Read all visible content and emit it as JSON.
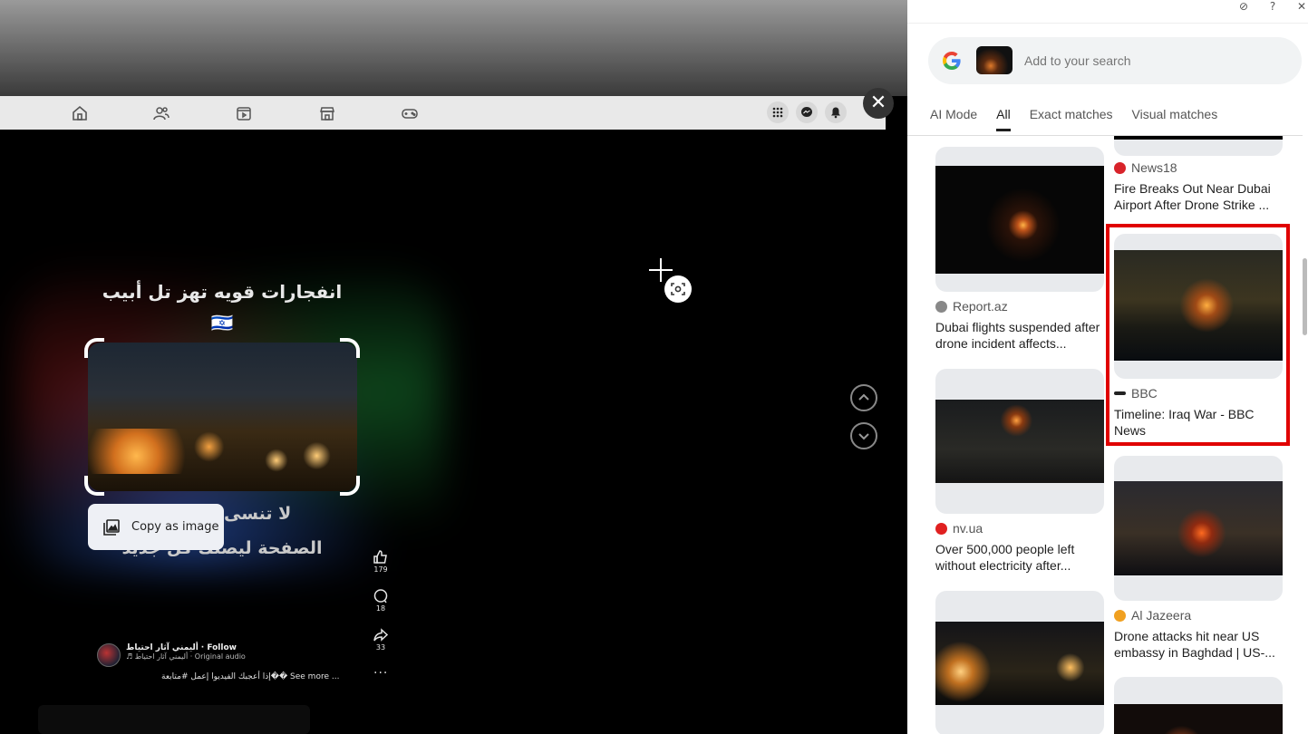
{
  "facebook": {
    "nav_icons": [
      "home-icon",
      "friends-icon",
      "video-icon",
      "marketplace-icon",
      "gaming-icon"
    ],
    "right_icons": [
      "menu-grid-icon",
      "messenger-icon",
      "notifications-icon"
    ],
    "close_label": "✕"
  },
  "reel": {
    "caption_top_line1": "انفجارات قويه تهز تل أبيب 🇮🇱",
    "caption_top_line2": "🇮🇷🚀",
    "caption_bottom_line1": "لا تنسى مشاركة",
    "caption_bottom_line2": "الصفحة ليصلك كل جديد",
    "copy_as_image": "Copy as image",
    "likes": "179",
    "comments": "18",
    "shares": "33",
    "more": "···",
    "author_name": "أليمني آثار احتياط",
    "follow": "· Follow",
    "audio": "♬ أليمني آثار احتياط · Original audio",
    "description": "إذا أعجبك الفيديوا إعمل #متابعة�� See more ..."
  },
  "lens_panel": {
    "search_placeholder": "Add to your search",
    "tabs": [
      "AI Mode",
      "All",
      "Exact matches",
      "Visual matches"
    ],
    "active_tab": "All",
    "results": [
      {
        "source": "",
        "title": ""
      },
      {
        "source": "News18",
        "title": "Fire Breaks Out Near Dubai Airport After Drone Strike ..."
      },
      {
        "source": "Report.az",
        "title": "Dubai flights suspended after drone incident affects..."
      },
      {
        "source": "BBC",
        "title": "Timeline: Iraq War - BBC News"
      },
      {
        "source": "nv.ua",
        "title": "Over 500,000 people left without electricity after..."
      },
      {
        "source": "Al Jazeera",
        "title": "Drone attacks hit near US embassy in Baghdad | US-..."
      }
    ],
    "colors": {
      "highlight": "#e00000",
      "text": "#1f1f1f"
    }
  }
}
